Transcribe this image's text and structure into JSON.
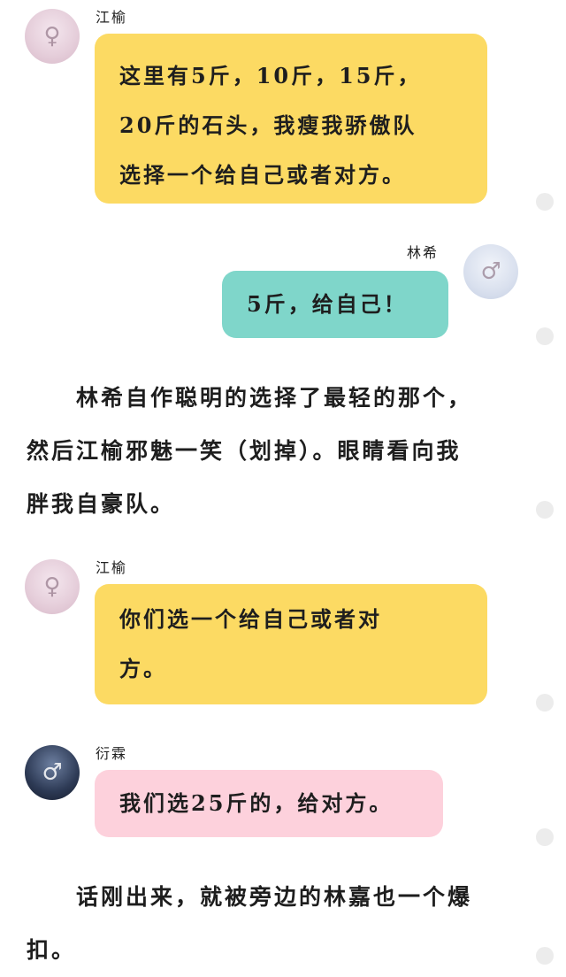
{
  "messages": [
    {
      "sender": "江榆",
      "avatar_icon": "girl-portrait-icon",
      "bubble_color": "#fcda63",
      "lines": [
        "这里有5斤，10斤，15斤，",
        "20斤的石头，我瘦我骄傲队",
        "选择一个给自己或者对方。"
      ]
    },
    {
      "sender": "林希",
      "avatar_icon": "boy-portrait-icon",
      "bubble_color": "#7fd6ca",
      "lines": [
        "5斤，给自己！"
      ]
    },
    {
      "sender": "江榆",
      "avatar_icon": "girl-portrait-icon",
      "bubble_color": "#fcda63",
      "lines": [
        "你们选一个给自己或者对",
        "方。"
      ]
    },
    {
      "sender": "衍霖",
      "avatar_icon": "man-portrait-icon",
      "bubble_color": "#fdd1dc",
      "lines": [
        "我们选25斤的，给对方。"
      ]
    }
  ],
  "narration": [
    {
      "lines": [
        "　　林希自作聪明的选择了最轻的那个，",
        "然后江榆邪魅一笑（划掉）。眼睛看向我",
        "胖我自豪队。"
      ]
    },
    {
      "lines": [
        "　　话刚出来，就被旁边的林嘉也一个爆",
        "扣。"
      ]
    }
  ]
}
